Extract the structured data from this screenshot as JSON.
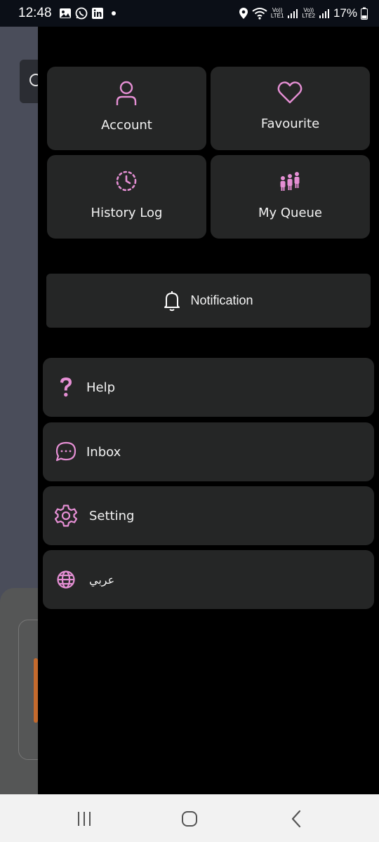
{
  "status_bar": {
    "time": "12:48",
    "volte1": "Vo))",
    "lte1": "LTE1",
    "volte2": "Vo))",
    "lte2": "LTE2",
    "battery": "17%"
  },
  "menu": {
    "account_label": "Account",
    "favourite_label": "Favourite",
    "history_label": "History Log",
    "queue_label": "My Queue",
    "notification_label": "Notification",
    "help_label": "Help",
    "inbox_label": "Inbox",
    "setting_label": "Setting",
    "language_label": "عربي"
  },
  "colors": {
    "accent": "#e58fd4",
    "tile_bg": "#252626",
    "drawer_bg": "#000000"
  },
  "icons": {
    "account": "user-icon",
    "favourite": "heart-icon",
    "history": "clock-icon",
    "queue": "people-icon",
    "notification": "bell-icon",
    "help": "question-icon",
    "inbox": "chat-icon",
    "setting": "gear-icon",
    "language": "globe-icon"
  }
}
